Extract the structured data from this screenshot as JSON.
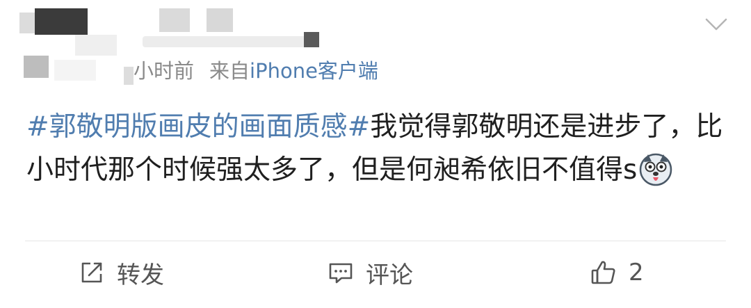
{
  "post": {
    "meta": {
      "time": "小时前",
      "source_prefix": "来自",
      "source": "iPhone客户端"
    },
    "content": {
      "hashtag": "#郭敬明版画皮的画面质感#",
      "text": "我觉得郭敬明还是进步了，比小时代那个时候强太多了，但是何昶希依旧不值得",
      "suffix": "s"
    },
    "icons": {
      "menu": "chevron-down-icon",
      "emoji": "husky-dog-emoji-icon",
      "repost": "repost-edit-icon",
      "comment": "comment-bubble-icon",
      "like": "thumbs-up-icon"
    },
    "actions": {
      "repost_label": "转发",
      "comment_label": "评论",
      "like_count": "2"
    }
  },
  "colors": {
    "link": "#507daf",
    "meta_text": "#8a8a8a",
    "body_text": "#1f1f1f",
    "divider": "#e6e6e6"
  }
}
